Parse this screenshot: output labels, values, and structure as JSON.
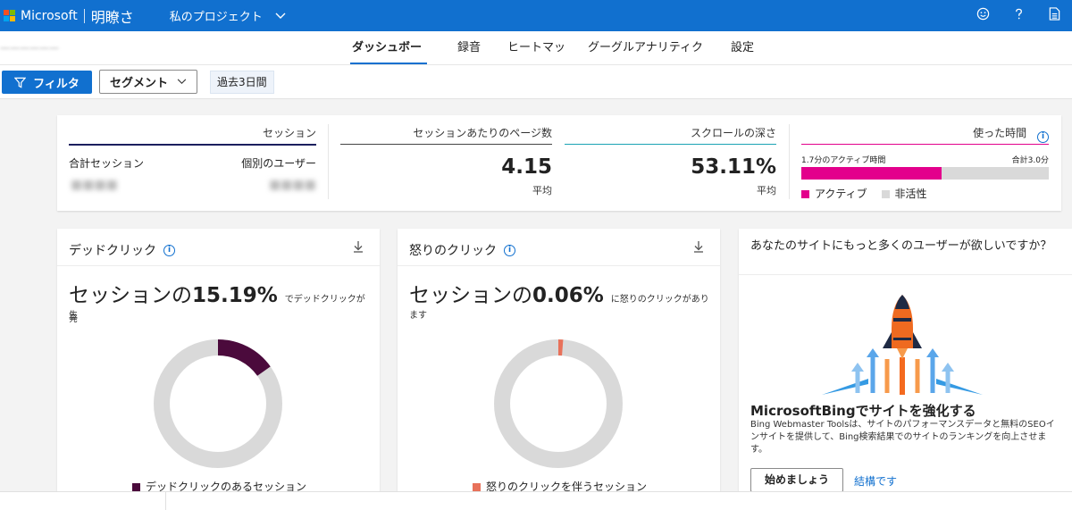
{
  "topbar": {
    "brand": "Microsoft",
    "product": "明瞭さ",
    "project": "私のプロジェクト",
    "icons": [
      "smiley-icon",
      "help-icon",
      "document-icon"
    ],
    "bg_color": "#1170cf"
  },
  "nav": {
    "tabs": [
      "ダッシュボード",
      "録音",
      "ヒートマップ",
      "グーグルアナリティクス",
      "設定"
    ],
    "active_index": 0
  },
  "filters": {
    "filter_label": "フィルタ",
    "segment_label": "セグメント",
    "date_range": "過去3日間"
  },
  "summary": {
    "sessions": {
      "title": "セッション",
      "total_label": "合計セッション",
      "unique_label": "個別のユーザー",
      "line_color": "#1b1f5e"
    },
    "pages_per_session": {
      "title": "セッションあたりのページ数",
      "value": "4.15",
      "sub": "平均",
      "line_color": "#444444"
    },
    "scroll_depth": {
      "title": "スクロールの深さ",
      "value": "53.11%",
      "sub": "平均",
      "line_color": "#1aa3b4"
    },
    "time_spent": {
      "title": "使った時間",
      "active_time": "1.7分のアクティブ時間",
      "total": "合計3.0分",
      "active_fraction": 0.5667,
      "legend_active": "アクティブ",
      "legend_inactive": "非活性",
      "active_color": "#e3008c",
      "inactive_color": "#d9d9d9"
    }
  },
  "dead_clicks": {
    "title": "デッドクリック",
    "pct_prefix": "セッションの",
    "pct": "15.19%",
    "suffix": "でデッドクリックが発",
    "suffix_wrap": "生",
    "fraction": 0.1519,
    "color": "#4b0a3c",
    "legend": "デッドクリックのあるセッション"
  },
  "rage_clicks": {
    "title": "怒りのクリック",
    "pct_prefix": "セッションの",
    "pct": "0.06%",
    "suffix": "に怒りのクリックがあり",
    "suffix_wrap": "ます",
    "fraction": 0.0006,
    "color": "#e8715a",
    "legend": "怒りのクリックを伴うセッション"
  },
  "promo": {
    "title": "あなたのサイトにもっと多くのユーザーが欲しいですか？",
    "heading": "MicrosoftBingでサイトを強化する",
    "body": "Bing Webmaster Toolsは、サイトのパフォーマンスデータと無料のSEOインサイトを提供して、Bing検索結果でのサイトのランキングを向上させます。",
    "button": "始めましょう",
    "link": "結構です"
  },
  "colors": {
    "accent": "#1170cf",
    "donut_track": "#d9d9d9"
  }
}
